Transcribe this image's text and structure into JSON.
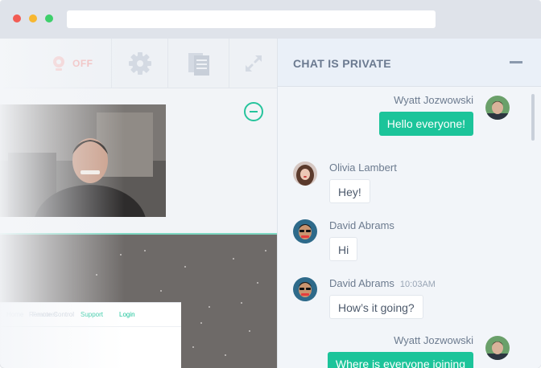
{
  "window": {
    "url": ""
  },
  "toolbar": {
    "camera_status": "OFF"
  },
  "webpage_nav": {
    "items": [
      "Home",
      "Features",
      "Remote Control",
      "Support",
      "Login"
    ]
  },
  "chat": {
    "title": "CHAT IS PRIVATE",
    "messages": [
      {
        "sender": "Wyatt Jozwowski",
        "time": "",
        "text": "Hello everyone!",
        "outgoing": true
      },
      {
        "sender": "Olivia Lambert",
        "time": "",
        "text": "Hey!",
        "outgoing": false
      },
      {
        "sender": "David Abrams",
        "time": "",
        "text": "Hi",
        "outgoing": false
      },
      {
        "sender": "David Abrams",
        "time": "10:03AM",
        "text": "How’s it going?",
        "outgoing": false
      },
      {
        "sender": "Wyatt Jozwowski",
        "time": "",
        "text": "Where is everyone joining",
        "outgoing": true
      }
    ]
  },
  "colors": {
    "accent": "#1cc49a",
    "header": "#6b7a90",
    "status_off": "#f1b2b2"
  }
}
